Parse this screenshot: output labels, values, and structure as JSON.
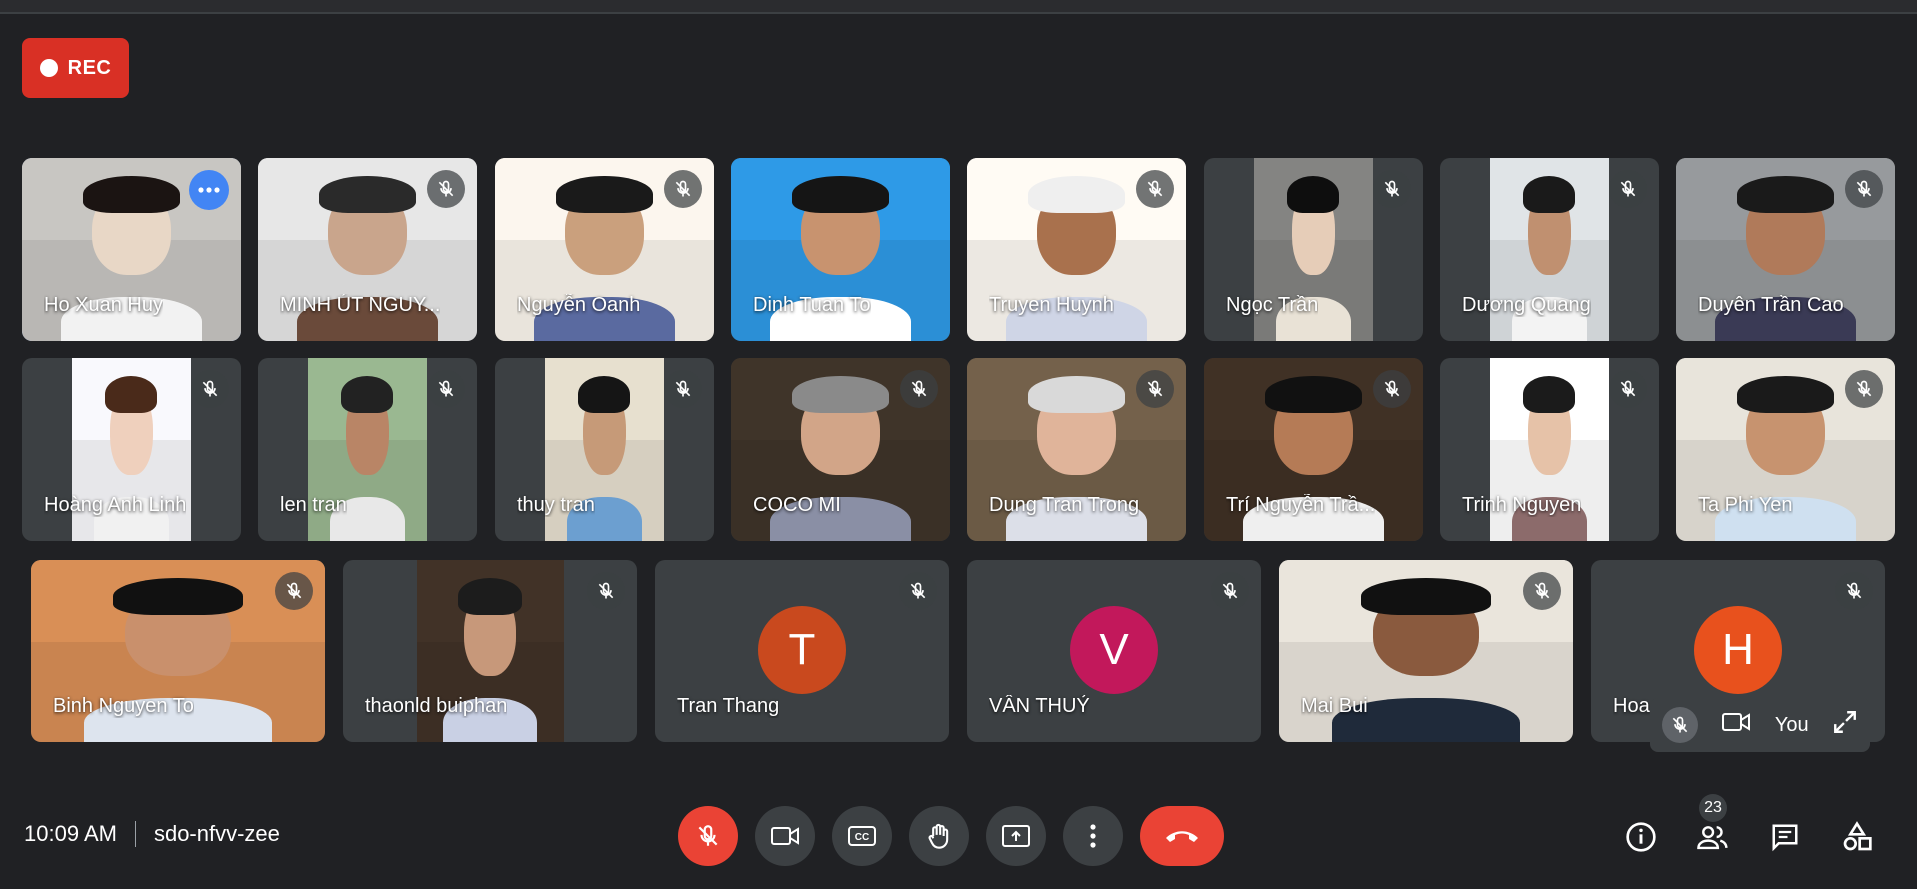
{
  "recording": {
    "label": "REC",
    "color": "#d93025"
  },
  "participants": [
    {
      "name": "Ho Xuan Huy",
      "muted": false,
      "active": true
    },
    {
      "name": "MINH ÚT NGUY...",
      "muted": true
    },
    {
      "name": "Nguyễn Oanh",
      "muted": true
    },
    {
      "name": "Dinh Tuan To",
      "muted": false
    },
    {
      "name": "Truyen Huynh",
      "muted": true
    },
    {
      "name": "Ngọc Trần",
      "muted": true
    },
    {
      "name": "Dương Quang",
      "muted": true
    },
    {
      "name": "Duyên Trần Cao",
      "muted": true
    },
    {
      "name": "Hoàng Anh Linh",
      "muted": true
    },
    {
      "name": "len tran",
      "muted": true
    },
    {
      "name": "thuy tran",
      "muted": true
    },
    {
      "name": "COCO MI",
      "muted": true
    },
    {
      "name": "Dung Tran Trong",
      "muted": true
    },
    {
      "name": "Trí Nguyễn Trầ...",
      "muted": true
    },
    {
      "name": "Trinh Nguyen",
      "muted": true
    },
    {
      "name": "Ta Phi Yen",
      "muted": true
    },
    {
      "name": "Binh Nguyen To",
      "muted": true
    },
    {
      "name": "thaonld buiphan",
      "muted": true
    },
    {
      "name": "Tran Thang",
      "muted": true,
      "initial": "T",
      "avatar_color": "#c9491e"
    },
    {
      "name": "VÂN THUỶ",
      "muted": true,
      "initial": "V",
      "avatar_color": "#c2185b"
    },
    {
      "name": "Mai Bui",
      "muted": true
    },
    {
      "name": "Hoa",
      "muted": true,
      "initial": "H",
      "avatar_color": "#e8511d"
    }
  ],
  "self_view": {
    "label": "You",
    "icons": [
      "mic-off-icon",
      "camera-icon",
      "expand-icon"
    ]
  },
  "meeting": {
    "time": "10:09 AM",
    "code": "sdo-nfvv-zee"
  },
  "controls": [
    "mic-off-icon",
    "camera-icon",
    "captions-icon",
    "raise-hand-icon",
    "present-icon",
    "more-vert-icon",
    "end-call-icon"
  ],
  "right_panel": {
    "participant_count": "23",
    "icons": [
      "info-icon",
      "people-icon",
      "chat-icon",
      "activities-icon"
    ]
  },
  "colors": {
    "background": "#202124",
    "tile": "#3c4043",
    "end_call": "#ea4335",
    "active_border": "#8ab4f8"
  }
}
